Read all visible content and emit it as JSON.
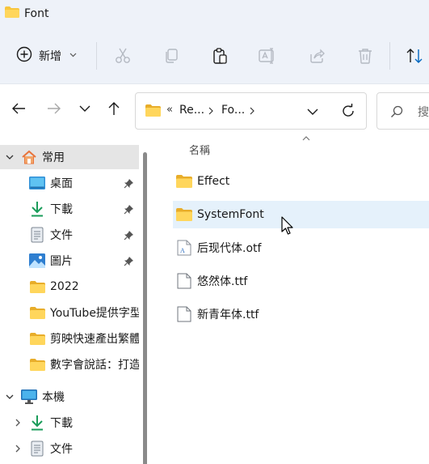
{
  "window": {
    "title": "Font"
  },
  "toolbar": {
    "new_label": "新增",
    "icons": [
      "cut-icon",
      "copy-icon",
      "paste-icon",
      "rename-icon",
      "share-icon",
      "delete-icon",
      "sort-icon"
    ]
  },
  "address": {
    "separator_start": "«",
    "crumbs": [
      "Re...",
      "Fo..."
    ],
    "search_placeholder": "搜"
  },
  "nav": {
    "quick_access_label": "常用",
    "pinned": [
      {
        "label": "桌面",
        "icon": "desktop-icon"
      },
      {
        "label": "下載",
        "icon": "download-icon"
      },
      {
        "label": "文件",
        "icon": "documents-icon"
      },
      {
        "label": "圖片",
        "icon": "pictures-icon"
      }
    ],
    "folders": [
      {
        "label": "2022"
      },
      {
        "label": "YouTube提供字型"
      },
      {
        "label": "剪映快速產出繁體"
      },
      {
        "label": "數字會說話：打造"
      }
    ],
    "this_pc_label": "本機",
    "pc_items": [
      {
        "label": "下載",
        "icon": "download-icon"
      },
      {
        "label": "文件",
        "icon": "documents-icon"
      }
    ]
  },
  "content": {
    "column_name": "名稱",
    "files": [
      {
        "name": "Effect",
        "type": "folder"
      },
      {
        "name": "SystemFont",
        "type": "folder",
        "hover": true
      },
      {
        "name": "后现代体.otf",
        "type": "otf"
      },
      {
        "name": "悠然体.ttf",
        "type": "ttf"
      },
      {
        "name": "新青年体.ttf",
        "type": "ttf"
      }
    ]
  },
  "colors": {
    "folder": "#f8c63d",
    "accent": "#0067c0",
    "hover_row": "#e5f1fb",
    "selected_nav": "#e5e5e5"
  }
}
